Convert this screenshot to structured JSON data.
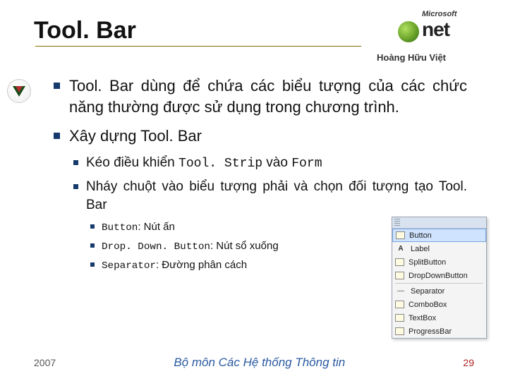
{
  "title": "Tool. Bar",
  "author": "Hoàng Hữu Việt",
  "logo": {
    "ms": "Microsoft",
    "net": "net"
  },
  "bullets": {
    "b1": "Tool. Bar dùng để chứa các biểu tượng của các chức năng thường được sử dụng trong chương trình.",
    "b2": "Xây dựng Tool. Bar",
    "b2a_pre": "Kéo điều khiển ",
    "b2a_code1": "Tool. Strip",
    "b2a_mid": " vào ",
    "b2a_code2": "Form",
    "b2b": "Nháy chuột vào biểu tượng phải và chọn đối tượng tạo Tool. Bar",
    "b2b1_code": "Button",
    "b2b1_txt": ": Nút ấn",
    "b2b2_code": "Drop. Down. Button",
    "b2b2_txt": ": Nút sổ xuống",
    "b2b3_code": "Separator",
    "b2b3_txt": ": Đường phân cách"
  },
  "menu": {
    "items": {
      "i0": "Button",
      "i1": "Label",
      "i2": "SplitButton",
      "i3": "DropDownButton",
      "i4": "Separator",
      "i5": "ComboBox",
      "i6": "TextBox",
      "i7": "ProgressBar"
    }
  },
  "footer": {
    "year": "2007",
    "dept": "Bộ môn Các Hệ thống Thông tin",
    "page": "29"
  }
}
